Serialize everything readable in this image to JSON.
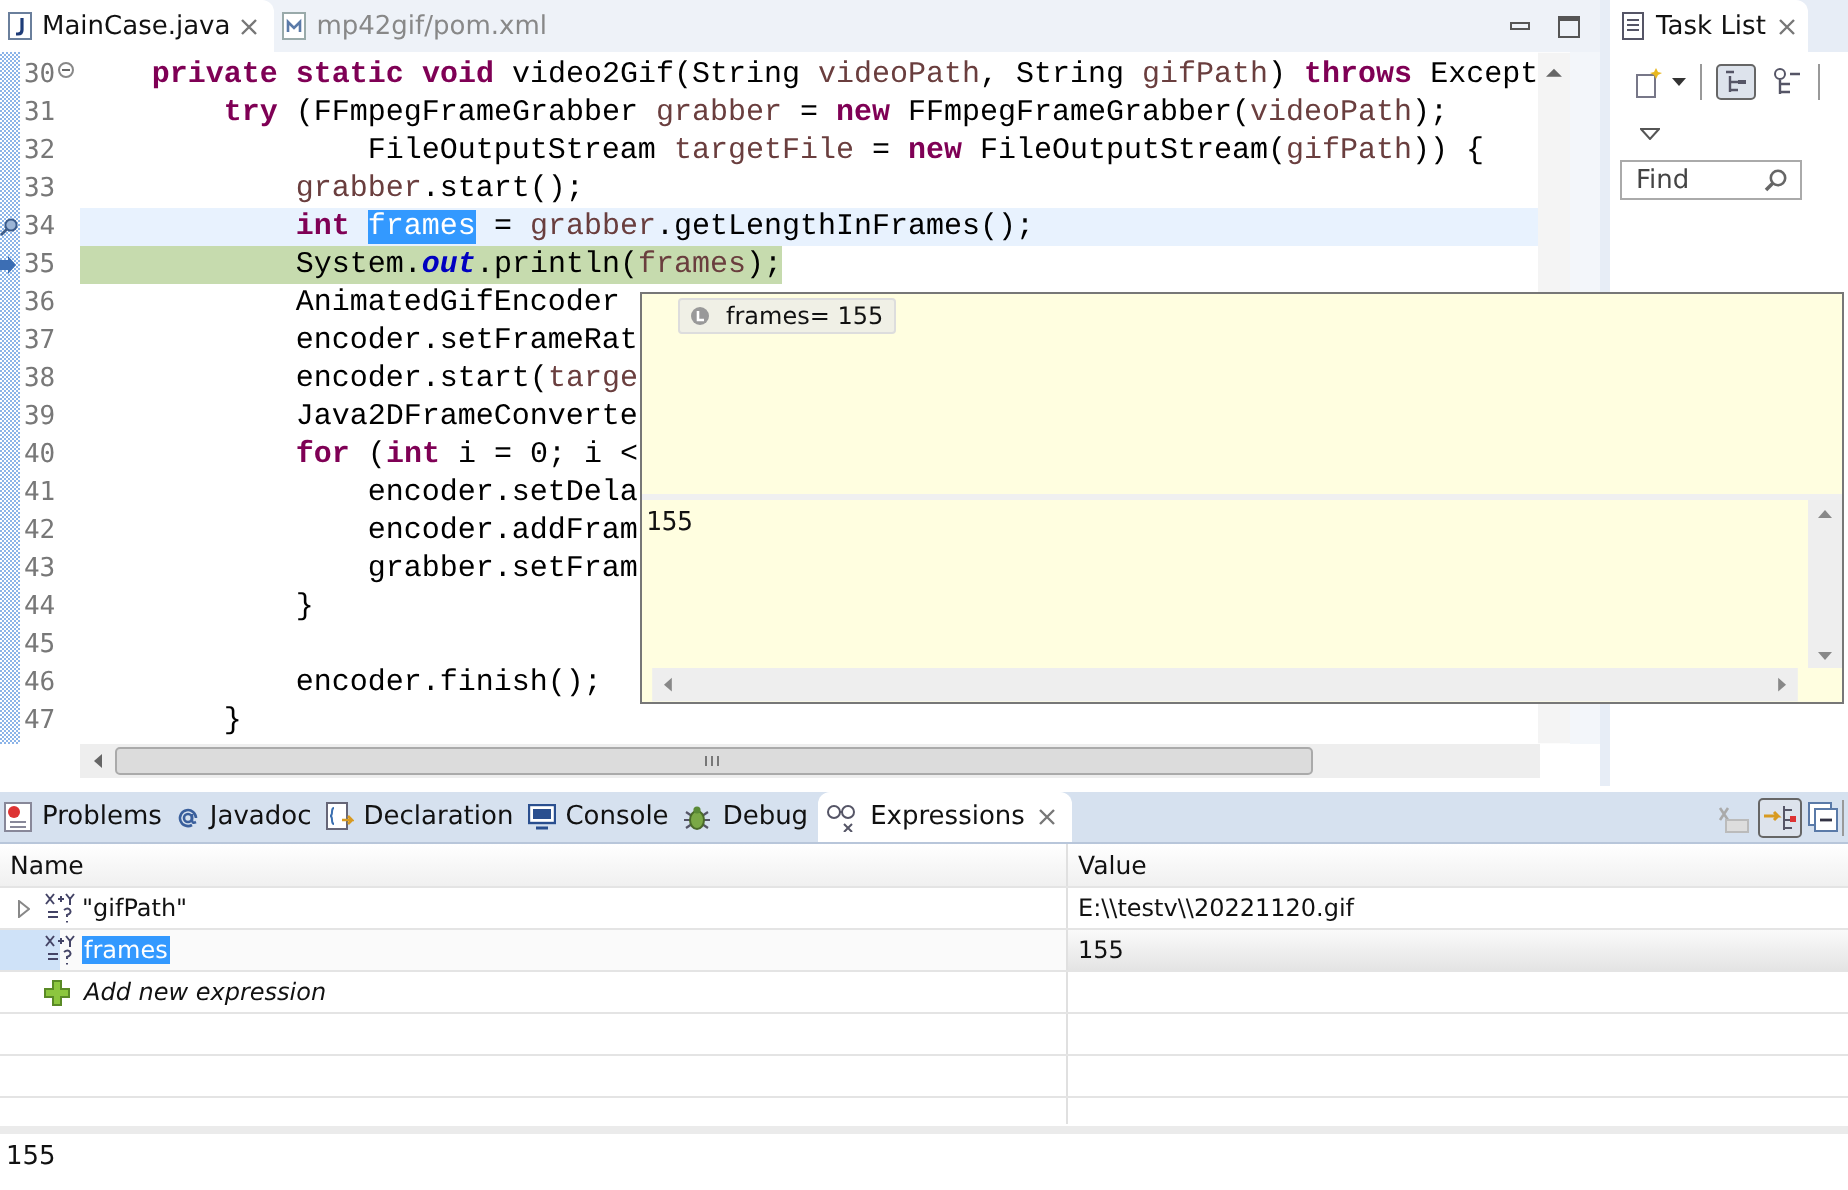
{
  "editor": {
    "tabs": [
      {
        "label": "MainCase.java",
        "selected": true,
        "closable": true,
        "kind": "java"
      },
      {
        "label": "mp42gif/pom.xml",
        "selected": false,
        "closable": false,
        "kind": "maven"
      }
    ],
    "lines": [
      {
        "number": "30",
        "fold": true,
        "current": false,
        "execution": false,
        "tokens": [
          {
            "t": "    private",
            "kind": "kw"
          },
          {
            "t": " static",
            "kind": "kw"
          },
          {
            "t": " void",
            "kind": "kw"
          },
          {
            "t": " video2Gif(String ",
            "kind": "p"
          },
          {
            "t": "videoPath",
            "kind": "v"
          },
          {
            "t": ", String ",
            "kind": "p"
          },
          {
            "t": "gifPath",
            "kind": "v"
          },
          {
            "t": ") ",
            "kind": "p"
          },
          {
            "t": "throws",
            "kind": "kw"
          },
          {
            "t": " Except",
            "kind": "p"
          }
        ]
      },
      {
        "number": "31",
        "fold": false,
        "current": false,
        "execution": false,
        "tokens": [
          {
            "t": "        try",
            "kind": "kw"
          },
          {
            "t": " (FFmpegFrameGrabber ",
            "kind": "p"
          },
          {
            "t": "grabber",
            "kind": "v"
          },
          {
            "t": " = ",
            "kind": "p"
          },
          {
            "t": "new",
            "kind": "kw"
          },
          {
            "t": " FFmpegFrameGrabber(",
            "kind": "p"
          },
          {
            "t": "videoPath",
            "kind": "v"
          },
          {
            "t": ");",
            "kind": "p"
          }
        ]
      },
      {
        "number": "32",
        "fold": false,
        "current": false,
        "execution": false,
        "tokens": [
          {
            "t": "                FileOutputStream ",
            "kind": "p"
          },
          {
            "t": "targetFile",
            "kind": "v"
          },
          {
            "t": " = ",
            "kind": "p"
          },
          {
            "t": "new",
            "kind": "kw"
          },
          {
            "t": " FileOutputStream(",
            "kind": "p"
          },
          {
            "t": "gifPath",
            "kind": "v"
          },
          {
            "t": ")) {",
            "kind": "p"
          }
        ]
      },
      {
        "number": "33",
        "fold": false,
        "current": false,
        "execution": false,
        "tokens": [
          {
            "t": "            grabber",
            "kind": "v"
          },
          {
            "t": ".start();",
            "kind": "p"
          }
        ]
      },
      {
        "number": "34",
        "fold": false,
        "current": true,
        "execution": false,
        "tokens": [
          {
            "t": "            int ",
            "kind": "kw"
          },
          {
            "t": "frames",
            "kind": "sel"
          },
          {
            "t": " = ",
            "kind": "p"
          },
          {
            "t": "grabber",
            "kind": "v"
          },
          {
            "t": ".getLengthInFrames();",
            "kind": "p"
          }
        ]
      },
      {
        "number": "35",
        "fold": false,
        "current": false,
        "execution": true,
        "tokens": [
          {
            "t": "            System.",
            "kind": "p"
          },
          {
            "t": "out",
            "kind": "f"
          },
          {
            "t": ".println(",
            "kind": "p"
          },
          {
            "t": "frames",
            "kind": "v"
          },
          {
            "t": ");",
            "kind": "p"
          }
        ]
      },
      {
        "number": "36",
        "fold": false,
        "current": false,
        "execution": false,
        "tokens": [
          {
            "t": "            AnimatedGifEncoder",
            "kind": "p"
          }
        ]
      },
      {
        "number": "37",
        "fold": false,
        "current": false,
        "execution": false,
        "tokens": [
          {
            "t": "            encoder.setFrameRat",
            "kind": "p"
          }
        ]
      },
      {
        "number": "38",
        "fold": false,
        "current": false,
        "execution": false,
        "tokens": [
          {
            "t": "            encoder.start(",
            "kind": "p"
          },
          {
            "t": "targe",
            "kind": "v"
          }
        ]
      },
      {
        "number": "39",
        "fold": false,
        "current": false,
        "execution": false,
        "tokens": [
          {
            "t": "            Java2DFrameConverte",
            "kind": "p"
          }
        ]
      },
      {
        "number": "40",
        "fold": false,
        "current": false,
        "execution": false,
        "tokens": [
          {
            "t": "            for",
            "kind": "kw"
          },
          {
            "t": " (",
            "kind": "p"
          },
          {
            "t": "int",
            "kind": "kw"
          },
          {
            "t": " i = 0; i <",
            "kind": "p"
          }
        ]
      },
      {
        "number": "41",
        "fold": false,
        "current": false,
        "execution": false,
        "tokens": [
          {
            "t": "                encoder.setDela",
            "kind": "p"
          }
        ]
      },
      {
        "number": "42",
        "fold": false,
        "current": false,
        "execution": false,
        "tokens": [
          {
            "t": "                encoder.addFram",
            "kind": "p"
          }
        ]
      },
      {
        "number": "43",
        "fold": false,
        "current": false,
        "execution": false,
        "tokens": [
          {
            "t": "                grabber.setFram",
            "kind": "p"
          }
        ]
      },
      {
        "number": "44",
        "fold": false,
        "current": false,
        "execution": false,
        "tokens": [
          {
            "t": "            }",
            "kind": "p"
          }
        ]
      },
      {
        "number": "45",
        "fold": false,
        "current": false,
        "execution": false
      },
      {
        "number": "46",
        "fold": false,
        "current": false,
        "execution": false,
        "tokens": [
          {
            "t": "            encoder.finish();",
            "kind": "p"
          }
        ]
      },
      {
        "number": "47",
        "fold": false,
        "current": false,
        "execution": false,
        "tokens": [
          {
            "t": "        }",
            "kind": "p"
          }
        ]
      }
    ]
  },
  "hover_popup": {
    "variable": "frames= 155",
    "detail": "155"
  },
  "task_list": {
    "tab": {
      "label": "Task List",
      "selected": true
    },
    "find": {
      "placeholder": "Find"
    }
  },
  "bottom_panel": {
    "tabs": [
      {
        "label": "Problems",
        "kind": "problems",
        "selected": false,
        "closable": false
      },
      {
        "label": "Javadoc",
        "kind": "javadoc",
        "selected": false,
        "closable": false
      },
      {
        "label": "Declaration",
        "kind": "declaration",
        "selected": false,
        "closable": false
      },
      {
        "label": "Console",
        "kind": "console",
        "selected": false,
        "closable": false
      },
      {
        "label": "Debug",
        "kind": "debug",
        "selected": false,
        "closable": false
      },
      {
        "label": "Expressions",
        "kind": "expressions",
        "selected": true,
        "closable": true
      }
    ],
    "columns": [
      "Name",
      "Value"
    ],
    "rows": [
      {
        "kind": "expression",
        "name": "\"gifPath\"",
        "value": "E:\\\\testv\\\\20221120.gif",
        "expandable": true,
        "selected": false
      },
      {
        "kind": "expression",
        "name": "frames",
        "value": "155",
        "expandable": false,
        "selected": true
      },
      {
        "kind": "add",
        "name": "Add new expression",
        "expandable": false,
        "selected": false
      }
    ],
    "detail": "155"
  }
}
